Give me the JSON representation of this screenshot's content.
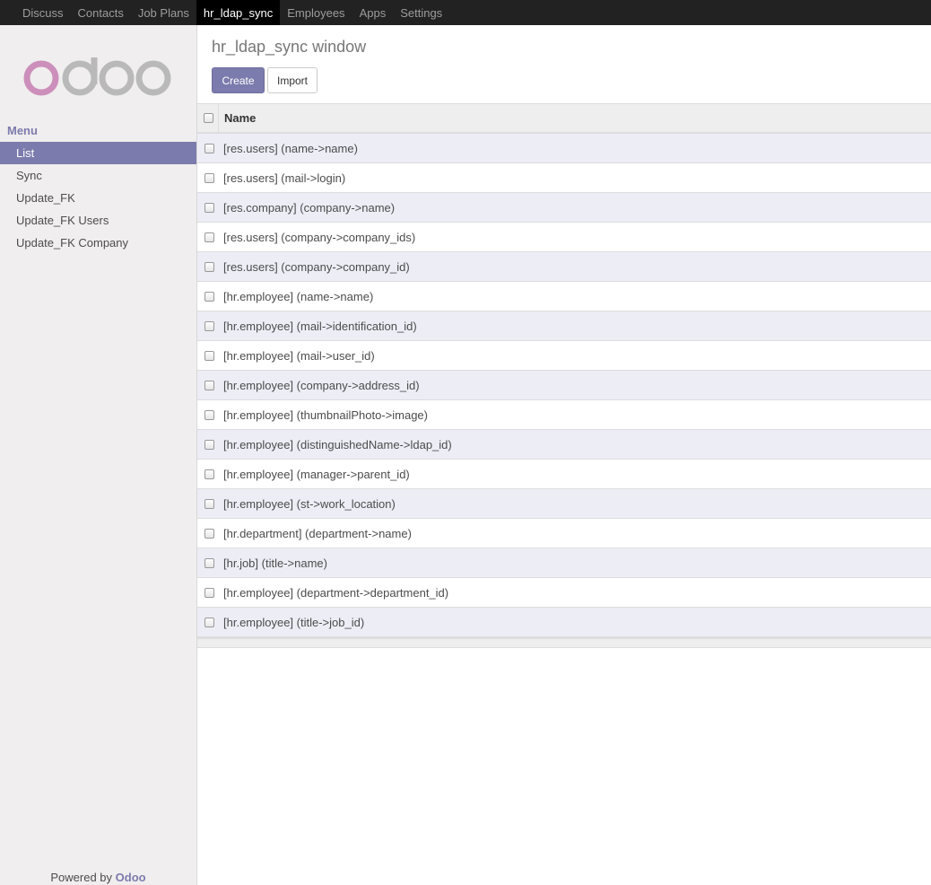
{
  "topnav": {
    "tabs": [
      {
        "label": "Discuss"
      },
      {
        "label": "Contacts"
      },
      {
        "label": "Job Plans"
      },
      {
        "label": "hr_ldap_sync"
      },
      {
        "label": "Employees"
      },
      {
        "label": "Apps"
      },
      {
        "label": "Settings"
      }
    ],
    "active_index": 3
  },
  "sidebar": {
    "logo_icon": "odoo-logo",
    "logo_colors": {
      "o1": "#cc8fbb",
      "rest": "#b9b9b9"
    },
    "menu_title": "Menu",
    "items": [
      {
        "label": "List"
      },
      {
        "label": "Sync"
      },
      {
        "label": "Update_FK"
      },
      {
        "label": "Update_FK Users"
      },
      {
        "label": "Update_FK Company"
      }
    ],
    "active_index": 0,
    "powered_prefix": "Powered by",
    "powered_brand": "Odoo"
  },
  "main": {
    "title": "hr_ldap_sync window",
    "create_label": "Create",
    "import_label": "Import",
    "table": {
      "column_name": "Name",
      "rows": [
        "[res.users] (name->name)",
        "[res.users] (mail->login)",
        "[res.company] (company->name)",
        "[res.users] (company->company_ids)",
        "[res.users] (company->company_id)",
        "[hr.employee] (name->name)",
        "[hr.employee] (mail->identification_id)",
        "[hr.employee] (mail->user_id)",
        "[hr.employee] (company->address_id)",
        "[hr.employee] (thumbnailPhoto->image)",
        "[hr.employee] (distinguishedName->ldap_id)",
        "[hr.employee] (manager->parent_id)",
        "[hr.employee] (st->work_location)",
        "[hr.department] (department->name)",
        "[hr.job] (title->name)",
        "[hr.employee] (department->department_id)",
        "[hr.employee] (title->job_id)"
      ]
    }
  },
  "colors": {
    "accent": "#7c7bad",
    "topbar_bg": "#222222",
    "row_odd_bg": "#ededf6"
  }
}
